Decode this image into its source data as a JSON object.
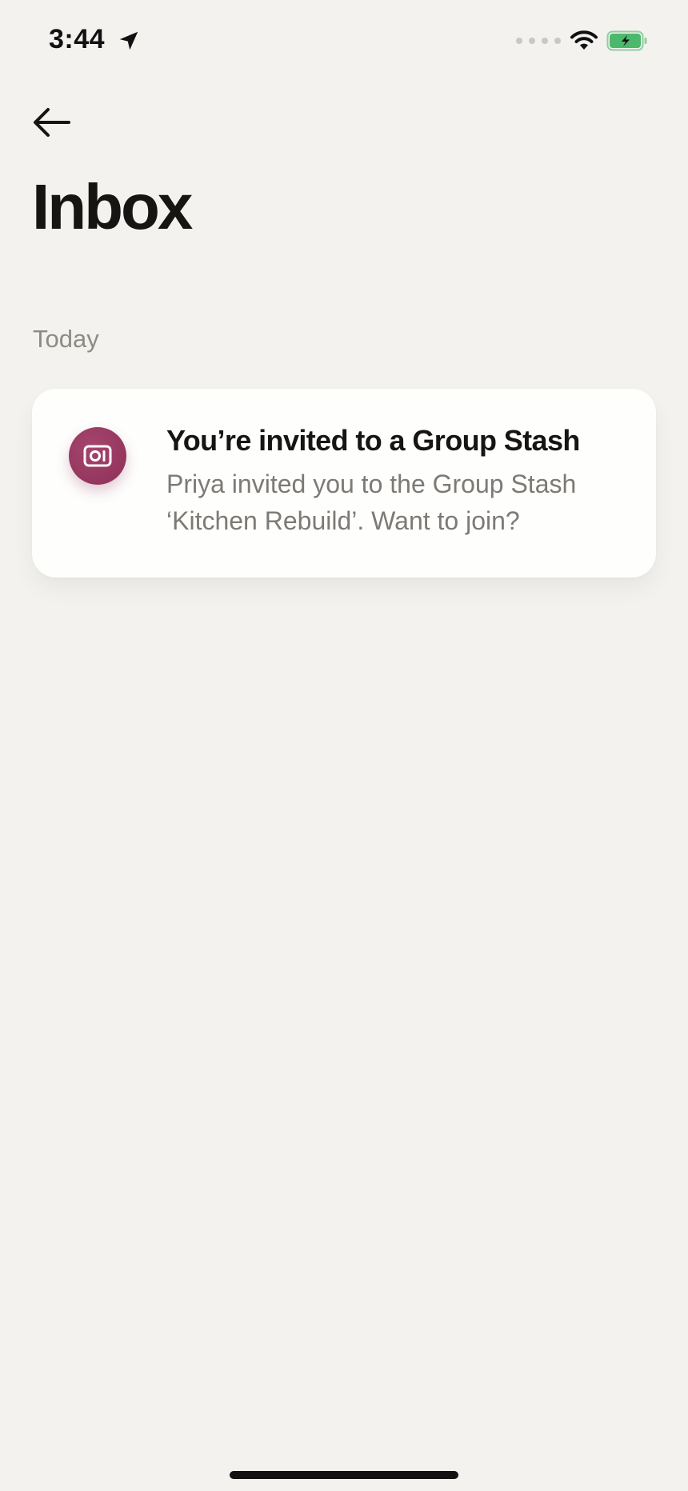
{
  "status_bar": {
    "time": "3:44",
    "icons": [
      "location-arrow-icon",
      "signal-dots-icon",
      "wifi-icon",
      "battery-charging-icon"
    ],
    "battery_color": "#4cb86b"
  },
  "header": {
    "back_icon": "arrow-left-icon",
    "title": "Inbox"
  },
  "sections": [
    {
      "label": "Today",
      "notifications": [
        {
          "icon": "group-stash-icon",
          "icon_color": "#8e2f57",
          "title": "You’re invited to a Group Stash",
          "body": "Priya invited you to the Group Stash ‘Kitchen Rebuild’. Want to join?"
        }
      ]
    }
  ],
  "colors": {
    "background": "#f3f2ef",
    "card": "#fefefd",
    "text_primary": "#161513",
    "text_secondary": "#7d7a76",
    "section_label": "#8e8b86"
  }
}
